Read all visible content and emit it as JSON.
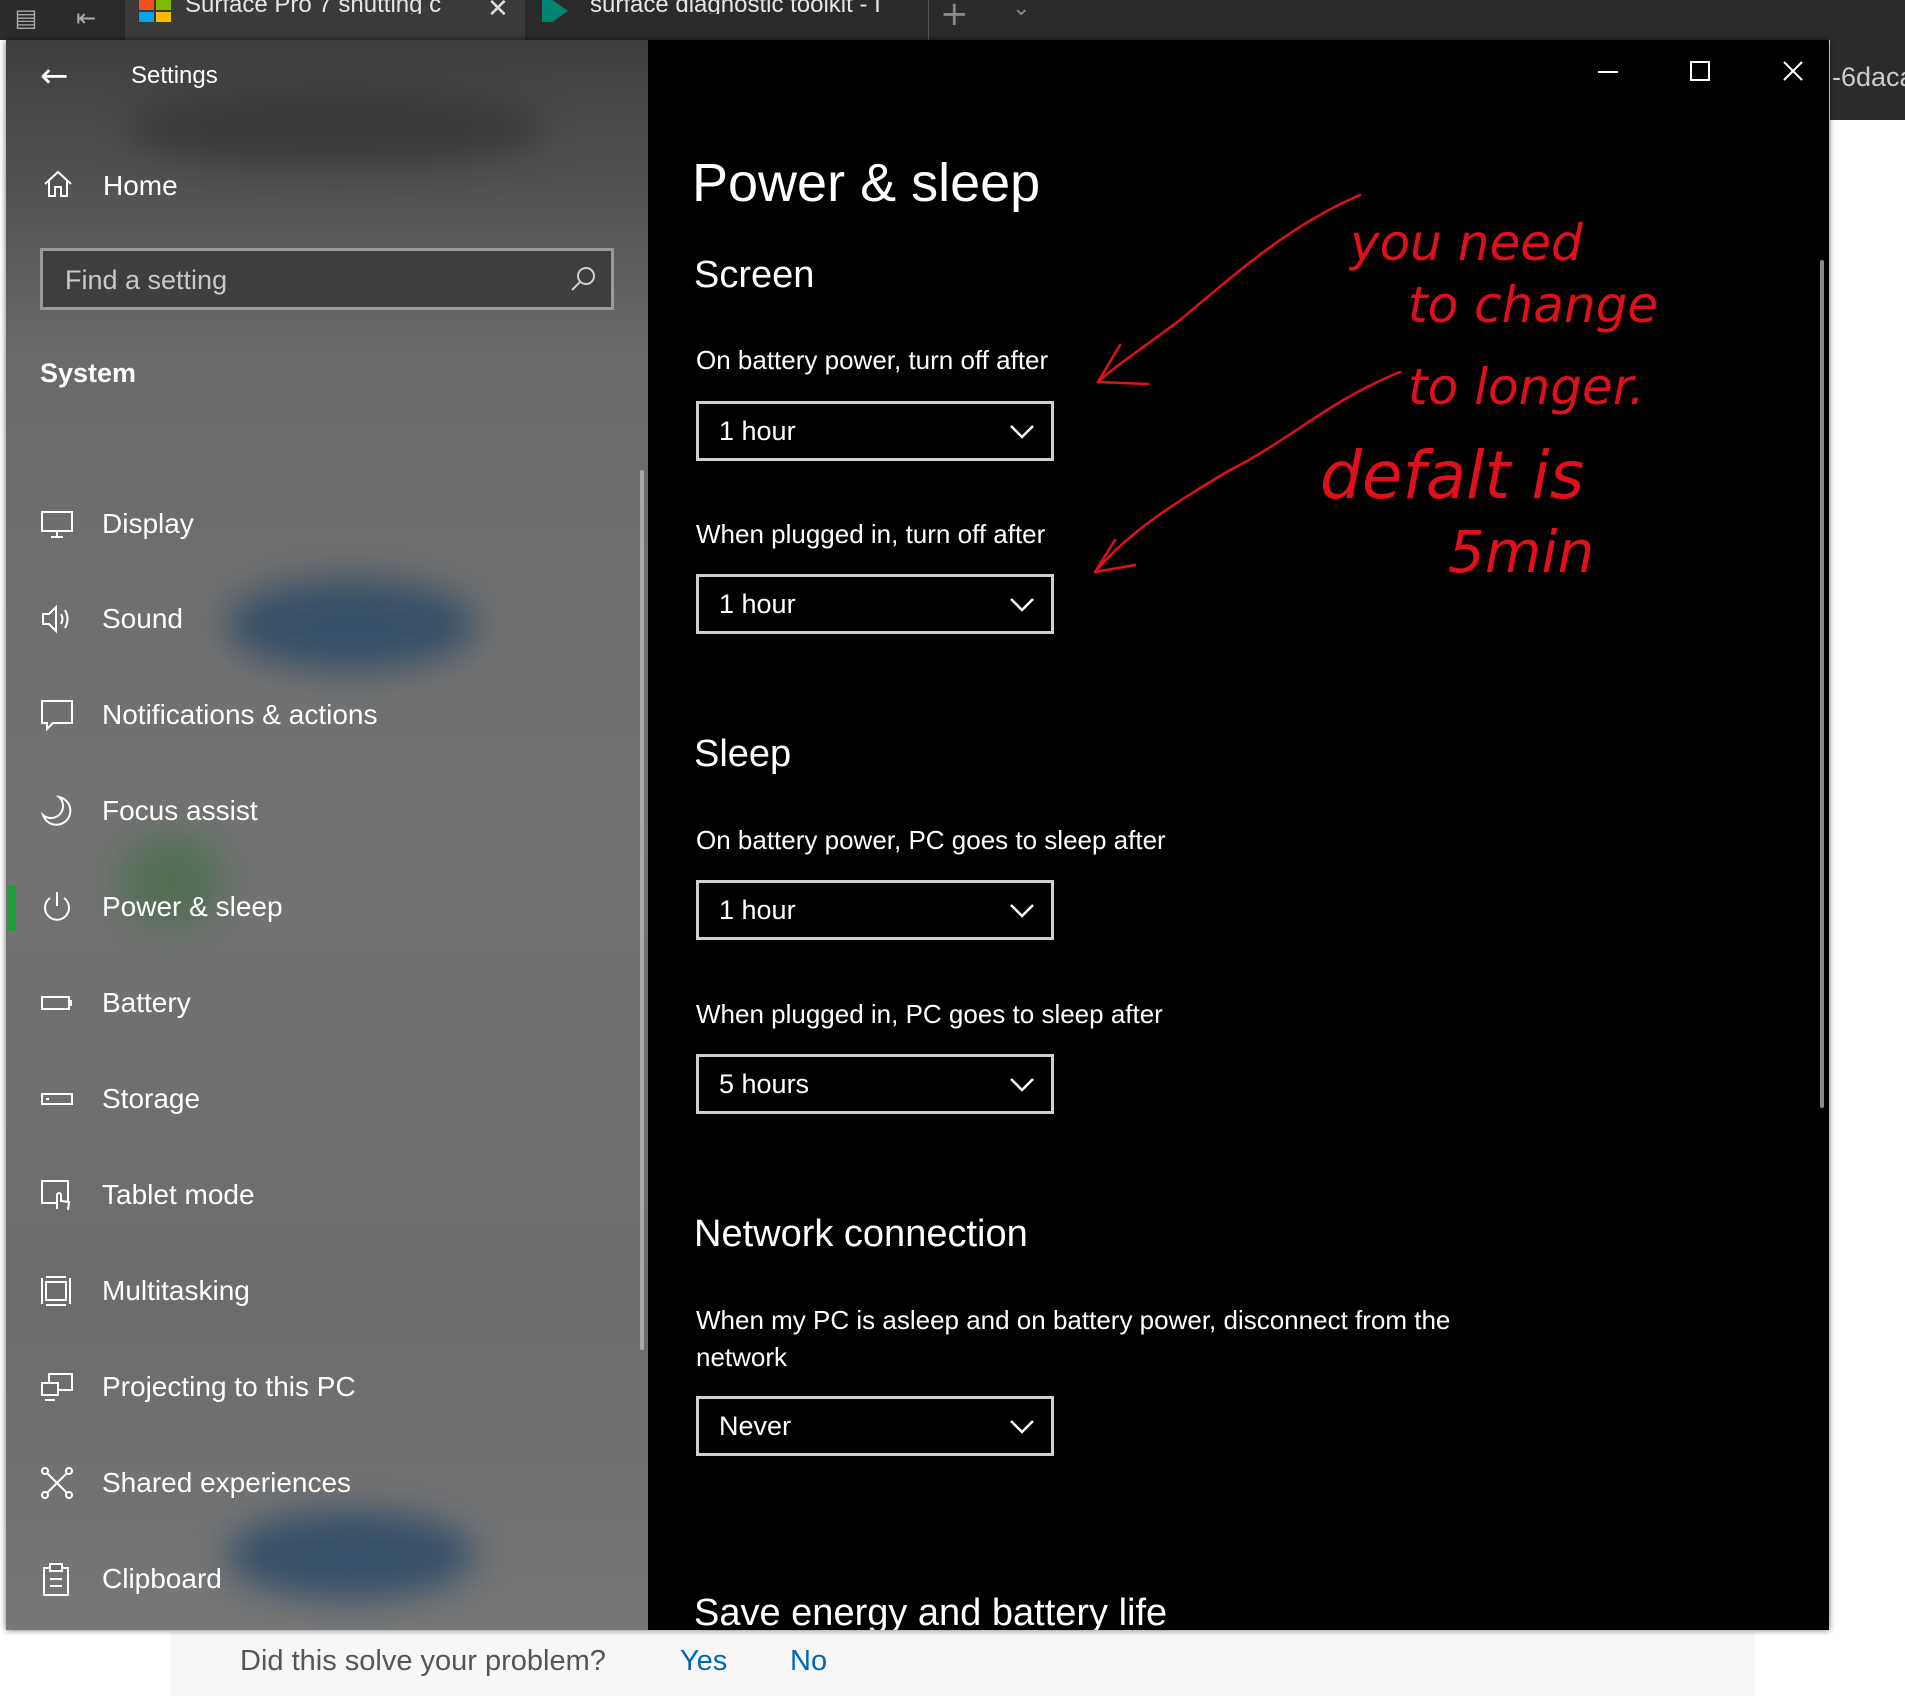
{
  "browser": {
    "tabs": [
      {
        "title": "Surface Pro 7 shutting c",
        "icon": "microsoft-logo-icon"
      },
      {
        "title": "surface diagnostic toolkit - I",
        "icon": "bing-logo-icon"
      }
    ],
    "right_fragment": "-6daca"
  },
  "settings": {
    "window_title": "Settings",
    "home_label": "Home",
    "search": {
      "placeholder": "Find a setting"
    },
    "category": "System",
    "nav": [
      {
        "label": "Display",
        "icon": "monitor-icon"
      },
      {
        "label": "Sound",
        "icon": "speaker-icon"
      },
      {
        "label": "Notifications & actions",
        "icon": "notification-icon"
      },
      {
        "label": "Focus assist",
        "icon": "moon-icon"
      },
      {
        "label": "Power & sleep",
        "icon": "power-icon",
        "selected": true
      },
      {
        "label": "Battery",
        "icon": "battery-icon"
      },
      {
        "label": "Storage",
        "icon": "storage-icon"
      },
      {
        "label": "Tablet mode",
        "icon": "tablet-mode-icon"
      },
      {
        "label": "Multitasking",
        "icon": "multitasking-icon"
      },
      {
        "label": "Projecting to this PC",
        "icon": "projecting-icon"
      },
      {
        "label": "Shared experiences",
        "icon": "shared-experiences-icon"
      },
      {
        "label": "Clipboard",
        "icon": "clipboard-icon"
      }
    ],
    "page_title": "Power & sleep",
    "screen": {
      "title": "Screen",
      "battery_label": "On battery power, turn off after",
      "battery_value": "1 hour",
      "plugged_label": "When plugged in, turn off after",
      "plugged_value": "1 hour"
    },
    "sleep": {
      "title": "Sleep",
      "battery_label": "On battery power, PC goes to sleep after",
      "battery_value": "1 hour",
      "plugged_label": "When plugged in, PC goes to sleep after",
      "plugged_value": "5 hours"
    },
    "network": {
      "title": "Network connection",
      "label": "When my PC is asleep and on battery power, disconnect from the network",
      "value": "Never"
    },
    "save_energy_title": "Save energy and battery life"
  },
  "annotation": {
    "color": "#e0101a",
    "lines": [
      "you need",
      "to change",
      "to longer.",
      "defalt is",
      "5min"
    ]
  },
  "feedback": {
    "question": "Did this solve your problem?",
    "yes": "Yes",
    "no": "No"
  },
  "colors": {
    "accent_selected": "#1e9e3a",
    "link": "#0067b8"
  }
}
